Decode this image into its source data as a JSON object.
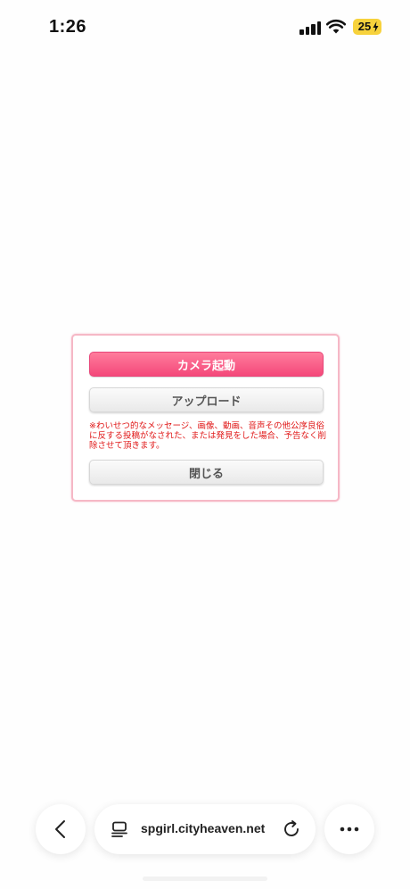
{
  "status_bar": {
    "time": "1:26",
    "battery": "25"
  },
  "dialog": {
    "camera_label": "カメラ起動",
    "upload_label": "アップロード",
    "notice": "※わいせつ的なメッセージ、画像、動画、音声その他公序良俗に反する投稿がなされた、または発見をした場合、予告なく削除させて頂きます。",
    "close_label": "閉じる"
  },
  "browser": {
    "url": "spgirl.cityheaven.net"
  },
  "icons": {
    "back": "chevron-left-icon",
    "tabs": "tab-list-icon",
    "reload": "reload-icon",
    "more": "ellipsis-icon"
  },
  "colors": {
    "accent": "#f4487a",
    "dialog_border": "#f6b8c6",
    "notice": "#e01818"
  }
}
